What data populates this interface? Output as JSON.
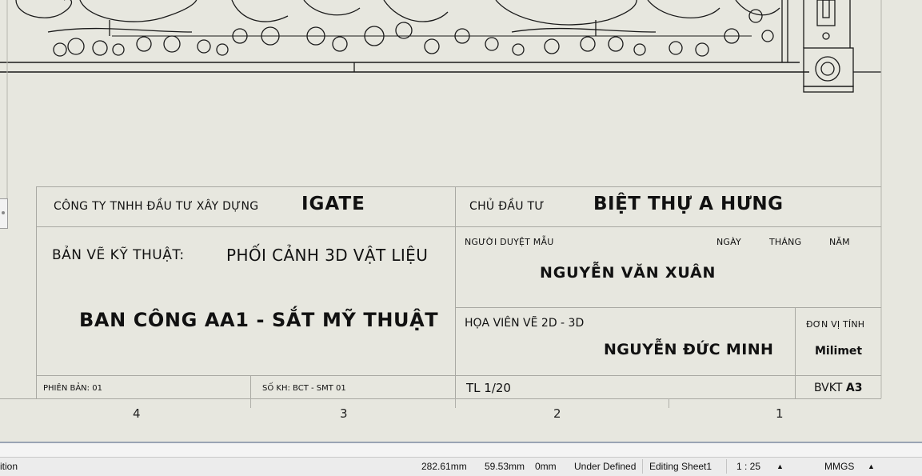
{
  "title_block": {
    "company_label": "CÔNG TY TNHH ĐẦU TƯ XÂY DỰNG",
    "company_name": "IGATE",
    "owner_label": "CHỦ ĐẦU TƯ",
    "owner_name": "BIỆT THỰ A HƯNG",
    "drawing_label": "BẢN VẼ KỸ THUẬT:",
    "drawing_type": "PHỐI CẢNH 3D VẬT LIỆU",
    "drawing_title": "BAN CÔNG AA1 - SẮT MỸ THUẬT",
    "approver_label": "NGƯỜI DUYỆT MẪU",
    "day_label": "NGÀY",
    "month_label": "THÁNG",
    "year_label": "NĂM",
    "approver_name": "NGUYỄN VĂN XUÂN",
    "designer_label": "HỌA VIÊN VẼ 2D - 3D",
    "designer_name": "NGUYỄN ĐỨC MINH",
    "unit_label": "ĐƠN VỊ  TÍNH",
    "unit_value": "Milimet",
    "version": "PHIÊN BẢN: 01",
    "doc_number": "SỐ KH: BCT - SMT 01",
    "scale": "TL 1/20",
    "sheet_size_label": "BVKT",
    "sheet_size_value": "A3"
  },
  "zones": [
    "4",
    "3",
    "2",
    "1"
  ],
  "status_bar": {
    "left_text": "ition",
    "x_coord": "282.61mm",
    "y_coord": "59.53mm",
    "z_coord": "0mm",
    "definition": "Under Defined",
    "editing": "Editing Sheet1",
    "sheet_scale": "1 : 25",
    "units": "MMGS"
  }
}
